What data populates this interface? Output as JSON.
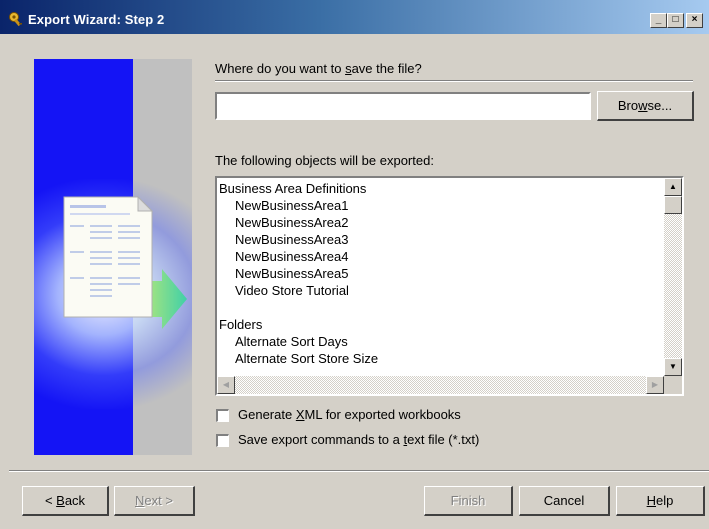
{
  "window": {
    "title": "Export Wizard: Step 2",
    "controls": {
      "minimize": "_",
      "maximize": "□",
      "close": "×"
    }
  },
  "save_section": {
    "prompt_pre": "Where do you want to ",
    "prompt_key": "s",
    "prompt_post": "ave the file?",
    "file_path_value": "",
    "browse_pre": "Bro",
    "browse_key": "w",
    "browse_post": "se..."
  },
  "objects_section": {
    "label": "The following objects will be exported:",
    "lines": [
      {
        "text": "Business Area Definitions",
        "indent": false
      },
      {
        "text": "NewBusinessArea1",
        "indent": true
      },
      {
        "text": "NewBusinessArea2",
        "indent": true
      },
      {
        "text": "NewBusinessArea3",
        "indent": true
      },
      {
        "text": "NewBusinessArea4",
        "indent": true
      },
      {
        "text": "NewBusinessArea5",
        "indent": true
      },
      {
        "text": "Video Store Tutorial",
        "indent": true
      },
      {
        "text": "",
        "indent": false
      },
      {
        "text": "Folders",
        "indent": false
      },
      {
        "text": "Alternate Sort Days",
        "indent": true
      },
      {
        "text": "Alternate Sort Store Size",
        "indent": true
      }
    ]
  },
  "options": {
    "xml_pre": "Generate ",
    "xml_key": "X",
    "xml_post": "ML for exported workbooks",
    "xml_checked": false,
    "txt_pre": "Save export commands to a ",
    "txt_key": "t",
    "txt_post": "ext file (*.txt)",
    "txt_checked": false
  },
  "footer": {
    "back_pre": "< ",
    "back_key": "B",
    "back_post": "ack",
    "next_pre": "",
    "next_key": "N",
    "next_post": "ext >",
    "finish": "Finish",
    "cancel": "Cancel",
    "help_pre": "",
    "help_key": "H",
    "help_post": "elp"
  },
  "icons": {
    "window_icon": "wizard-key-icon",
    "art": "exported-document-arrow-illustration"
  },
  "colors": {
    "titlebar_start": "#0a246a",
    "titlebar_end": "#a6caf0",
    "dialog_face": "#d4d0c8",
    "art_blue": "#1414f5"
  }
}
